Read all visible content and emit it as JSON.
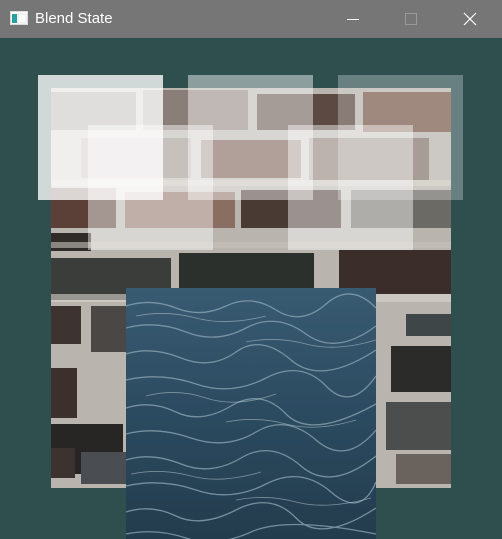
{
  "window": {
    "title": "Blend State",
    "background_color": "#2f4f4f",
    "titlebar_color": "#767676"
  },
  "titlebar_buttons": {
    "minimize_icon": "minimize-icon",
    "maximize_icon": "maximize-icon",
    "close_icon": "close-icon"
  },
  "scene": {
    "textures": [
      "brick-wall",
      "water"
    ]
  }
}
